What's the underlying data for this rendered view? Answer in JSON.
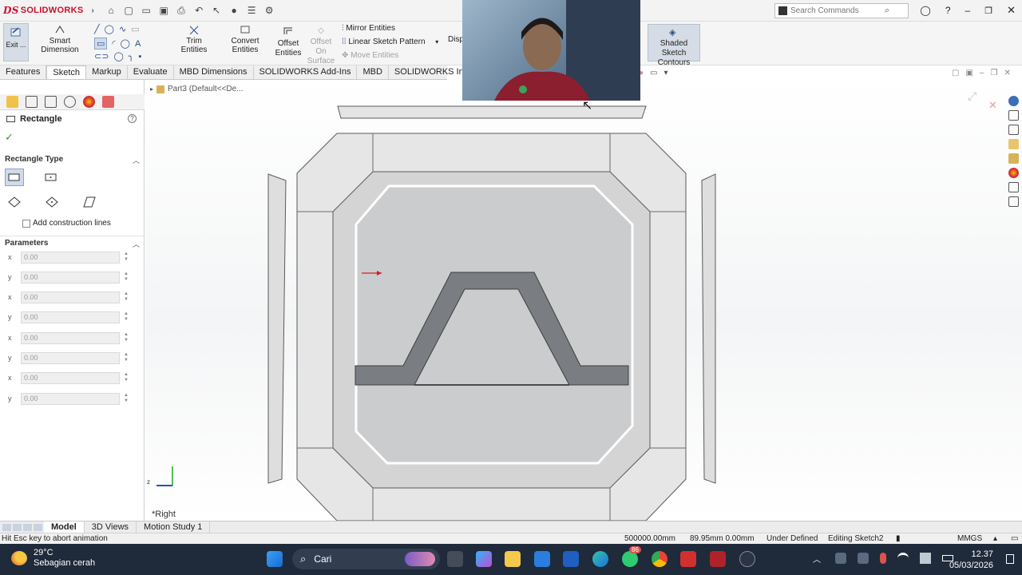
{
  "app": {
    "brand": "SOLIDWORKS",
    "search_placeholder": "Search Commands"
  },
  "ribbon": {
    "exit_label": "Exit ...",
    "smart_dimension": "Smart Dimension",
    "trim_entities": "Trim Entities",
    "convert_entities": "Convert Entities",
    "offset_entities_1": "Offset",
    "offset_entities_2": "Entities",
    "offset_on_surface_1": "Offset On",
    "offset_on_surface_2": "Surface",
    "mirror_entities": "Mirror Entities",
    "linear_sketch_pattern": "Linear Sketch Pattern",
    "move_entities": "Move Entities",
    "display_label": "Disp",
    "shaded_sketch_1": "Shaded Sketch",
    "shaded_sketch_2": "Contours"
  },
  "tabs": [
    "Features",
    "Sketch",
    "Markup",
    "Evaluate",
    "MBD Dimensions",
    "SOLIDWORKS Add-Ins",
    "MBD",
    "SOLIDWORKS Inspection"
  ],
  "active_tab": "Sketch",
  "property_manager": {
    "title": "Rectangle",
    "section_type": "Rectangle Type",
    "construction_label": "Add construction lines",
    "section_params": "Parameters",
    "params": [
      {
        "axis": "x",
        "value": "0.00"
      },
      {
        "axis": "y",
        "value": "0.00"
      },
      {
        "axis": "x",
        "value": "0.00"
      },
      {
        "axis": "y",
        "value": "0.00"
      },
      {
        "axis": "x",
        "value": "0.00"
      },
      {
        "axis": "y",
        "value": "0.00"
      },
      {
        "axis": "x",
        "value": "0.00"
      },
      {
        "axis": "y",
        "value": "0.00"
      }
    ]
  },
  "viewport": {
    "tree_label": "Part3  (Default<<De...",
    "view_name": "*Right"
  },
  "bottom_tabs": [
    "Model",
    "3D Views",
    "Motion Study 1"
  ],
  "status": {
    "hint": "Hit Esc key to abort animation",
    "scale": "500000.00mm",
    "coords": "89.95mm  0.00mm",
    "state": "Under Defined",
    "editing": "Editing Sketch2",
    "units": "MMGS"
  },
  "taskbar": {
    "temp": "29°C",
    "weather": "Sebagian cerah",
    "search": "Cari",
    "time": "12.37",
    "date": "05/03/2026",
    "whatsapp_badge": "86"
  },
  "colors": {
    "accent_red": "#c8102e",
    "selection_blue": "#cfdbea",
    "model_gray": "#d9d9d9",
    "profile_dark": "#7a7d82"
  }
}
